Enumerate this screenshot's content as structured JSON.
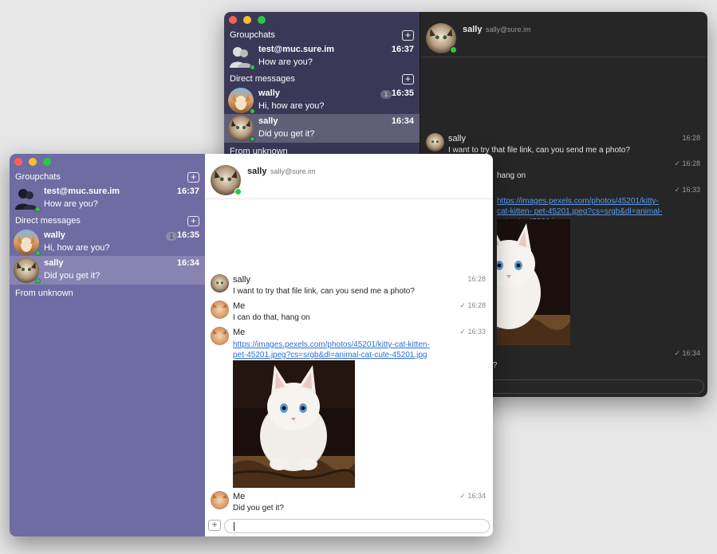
{
  "colors": {
    "front_sidebar": "#6f6ba3",
    "back_sidebar": "#3a3857",
    "back_main": "#262626",
    "online": "#28c840",
    "link": "#2a6fd6"
  },
  "sidebar": {
    "groupchats_label": "Groupchats",
    "direct_label": "Direct messages",
    "unknown_label": "From unknown",
    "add_icon": "+",
    "conversations": [
      {
        "name": "test@muc.sure.im",
        "preview": "How are you?",
        "time": "16:37",
        "avatar": "group-avatar"
      },
      {
        "name": "wally",
        "preview": "Hi, how are you?",
        "time": "16:35",
        "badge": "1",
        "avatar": "dog-avatar"
      },
      {
        "name": "sally",
        "preview": "Did you get it?",
        "time": "16:34",
        "avatar": "cat-avatar",
        "selected": true
      }
    ]
  },
  "chat": {
    "contact_name": "sally",
    "contact_jid": "sally@sure.im",
    "messages": [
      {
        "sender": "sally",
        "text": "I want to try that file link, can you send me a photo?",
        "time": "16:28"
      },
      {
        "sender": "Me",
        "text": "I can do that, hang on",
        "time": "✓ 16:28"
      },
      {
        "sender": "Me",
        "link": "https://images.pexels.com/photos/45201/kitty-cat-kitten-pet-45201.jpeg?cs=srgb&dl=animal-cat-cute-45201.jpg",
        "link_line1": "https://images.pexels.com/photos/45201/kitty-cat-kitten-",
        "link_line2": "pet-45201.jpeg?cs=srgb&dl=animal-cat-cute-45201.jpg",
        "time": "✓ 16:33",
        "image": "kitten-photo"
      },
      {
        "sender": "Me",
        "text": "Did you get it?",
        "time": "✓ 16:34"
      }
    ],
    "back_fragments": {
      "hang_on": "hang on",
      "did_you_get": "t?"
    }
  },
  "composer": {
    "add_icon": "+",
    "input_value": ""
  }
}
